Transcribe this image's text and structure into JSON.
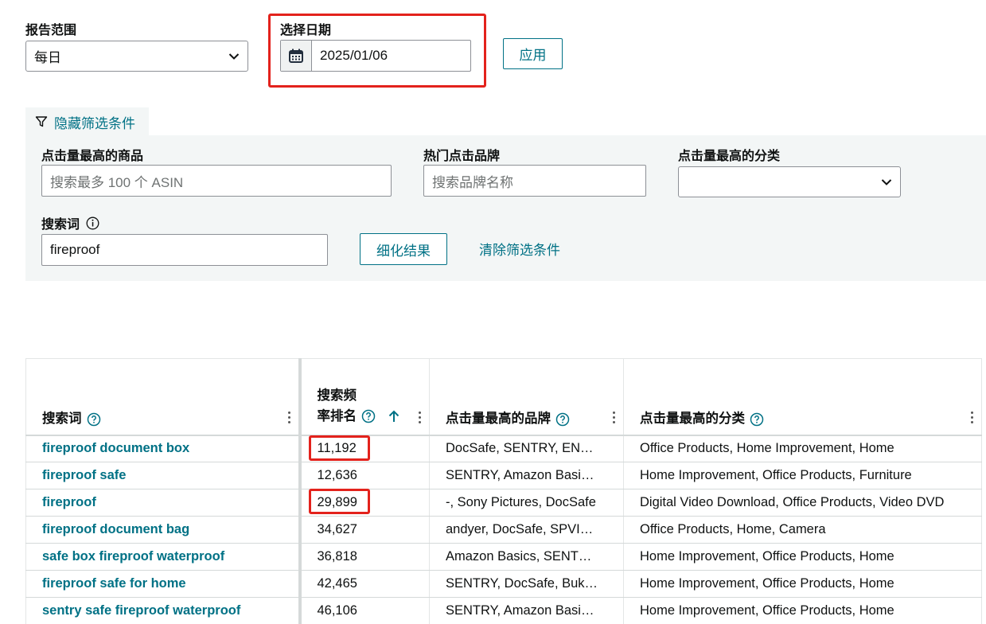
{
  "report_range": {
    "label": "报告范围",
    "value": "每日"
  },
  "date_picker": {
    "label": "选择日期",
    "value": "2025/01/06"
  },
  "apply_button": "应用",
  "filter_toggle": "隐藏筛选条件",
  "filters": {
    "top_product": {
      "label": "点击量最高的商品",
      "placeholder": "搜索最多 100 个 ASIN"
    },
    "top_brand": {
      "label": "热门点击品牌",
      "placeholder": "搜索品牌名称"
    },
    "top_category": {
      "label": "点击量最高的分类",
      "value": ""
    },
    "search_term": {
      "label": "搜索词",
      "value": "fireproof"
    },
    "refine_button": "细化结果",
    "clear_link": "清除筛选条件"
  },
  "table": {
    "headers": {
      "search_term": "搜索词",
      "rank_line1": "搜索频",
      "rank_line2": "率排名",
      "brand": "点击量最高的品牌",
      "category": "点击量最高的分类"
    },
    "rows": [
      {
        "term": "fireproof document box",
        "rank": "11,192",
        "brands": "DocSafe, SENTRY, EN…",
        "categories": "Office Products, Home Improvement, Home"
      },
      {
        "term": "fireproof safe",
        "rank": "12,636",
        "brands": "SENTRY, Amazon Basi…",
        "categories": "Home Improvement, Office Products, Furniture"
      },
      {
        "term": "fireproof",
        "rank": "29,899",
        "brands": "-, Sony Pictures, DocSafe",
        "categories": "Digital Video Download, Office Products, Video DVD"
      },
      {
        "term": "fireproof document bag",
        "rank": "34,627",
        "brands": "andyer, DocSafe, SPVI…",
        "categories": "Office Products, Home, Camera"
      },
      {
        "term": "safe box fireproof waterproof",
        "rank": "36,818",
        "brands": "Amazon Basics, SENT…",
        "categories": "Home Improvement, Office Products, Home"
      },
      {
        "term": "fireproof safe for home",
        "rank": "42,465",
        "brands": "SENTRY, DocSafe, Buk…",
        "categories": "Home Improvement, Office Products, Home"
      },
      {
        "term": "sentry safe fireproof waterproof",
        "rank": "46,106",
        "brands": "SENTRY, Amazon Basi…",
        "categories": "Home Improvement, Office Products, Home"
      }
    ]
  },
  "colors": {
    "accent": "#007185",
    "highlight": "#e3221c",
    "panel": "#f3f6f6"
  }
}
